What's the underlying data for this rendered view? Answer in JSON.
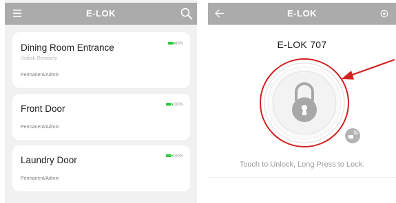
{
  "left_screen": {
    "header": {
      "title": "E-LOK",
      "menu_icon": "hamburger-menu-icon",
      "search_icon": "search-icon"
    },
    "locks": [
      {
        "name": "Dining Room Entrance",
        "status": "Unlock Remotely",
        "access": "Permanent/Admin",
        "battery": "80%"
      },
      {
        "name": "Front Door",
        "access": "Permanent/Admin",
        "battery": "100%"
      },
      {
        "name": "Laundry Door",
        "access": "Permanent/Admin",
        "battery": "100%"
      }
    ]
  },
  "right_screen": {
    "header": {
      "title": "E-LOK",
      "back_icon": "back-arrow-icon",
      "settings_icon": "settings-icon"
    },
    "device_name": "E-LOK 707",
    "unlock_button_icon": "padlock-icon",
    "badge_icon": "remote-key-icon",
    "hint": "Touch to Unlock, Long Press to Lock."
  },
  "annotation": {
    "highlight_color": "#d21f1f",
    "arrow_color": "#d21f1f"
  },
  "colors": {
    "header_bg": "#ababab",
    "list_bg": "#f1f1f1",
    "battery": "#2ecc40"
  }
}
